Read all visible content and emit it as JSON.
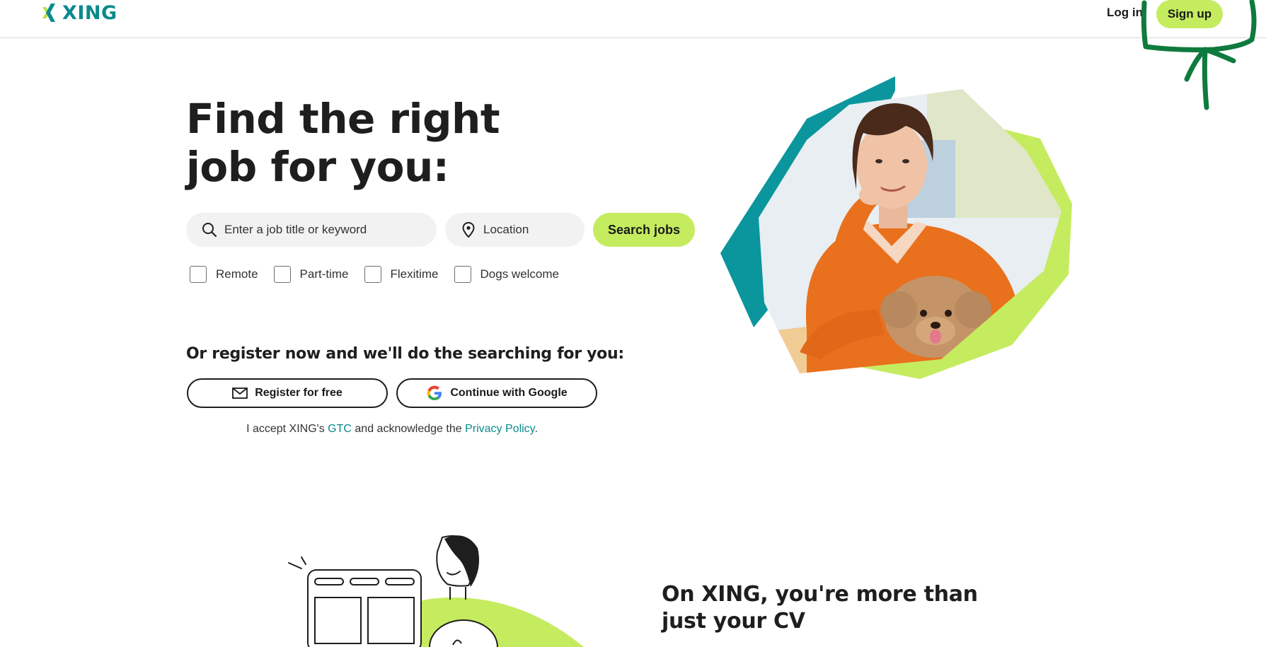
{
  "header": {
    "logo_text": "XING",
    "login_label": "Log in",
    "signup_label": "Sign up"
  },
  "hero": {
    "title": "Find the right job for you:",
    "keyword_placeholder": "Enter a job title or keyword",
    "location_placeholder": "Location",
    "search_button": "Search jobs",
    "filters": [
      "Remote",
      "Part-time",
      "Flexitime",
      "Dogs welcome"
    ]
  },
  "register": {
    "heading": "Or register now and we'll do the searching for you:",
    "register_button": "Register for free",
    "google_button": "Continue with Google",
    "legal_prefix": "I accept XING's",
    "gtc_link": "GTC",
    "legal_middle": "and acknowledge the",
    "privacy_link": "Privacy Policy",
    "legal_suffix": "."
  },
  "section": {
    "title": "On XING, you're more than just your CV"
  },
  "colors": {
    "brand_teal": "#0a8a8d",
    "brand_lime": "#c5ec5f",
    "annotation_green": "#0f7a3e"
  },
  "icons": [
    "xing-logo-icon",
    "search-icon",
    "location-pin-icon",
    "mail-icon",
    "google-icon"
  ]
}
